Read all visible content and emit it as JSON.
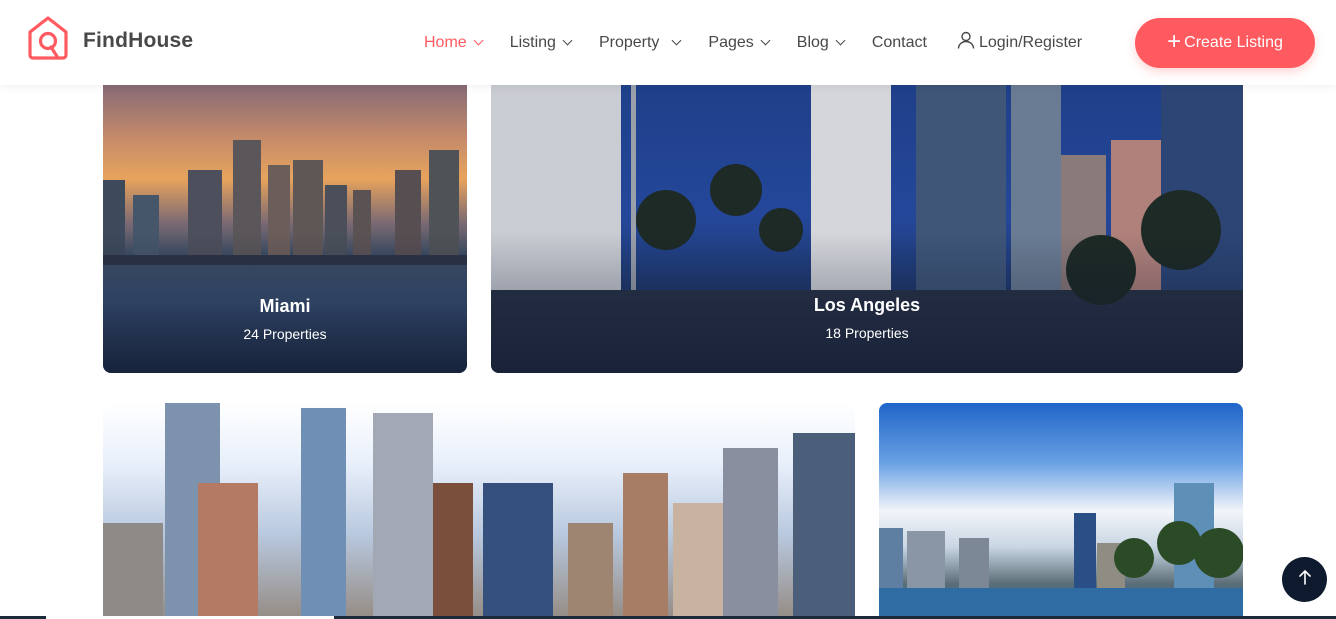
{
  "brand": {
    "name": "FindHouse",
    "accent": "#ff5a5f"
  },
  "nav": {
    "items": [
      {
        "label": "Home",
        "active": true,
        "dropdown": true
      },
      {
        "label": "Listing",
        "dropdown": true
      },
      {
        "label": "Property",
        "dropdown": true
      },
      {
        "label": "Pages",
        "dropdown": true
      },
      {
        "label": "Blog",
        "dropdown": true
      },
      {
        "label": "Contact",
        "dropdown": false
      }
    ],
    "login_label": "Login/Register",
    "cta_label": "Create Listing"
  },
  "cities": [
    {
      "name": "Miami",
      "properties": "24 Properties"
    },
    {
      "name": "Los Angeles",
      "properties": "18 Properties"
    },
    {
      "name": "",
      "properties": ""
    },
    {
      "name": "",
      "properties": ""
    }
  ],
  "icons": {
    "logo": "house-logo-icon",
    "user": "user-icon",
    "plus": "plus-icon",
    "back_to_top": "arrow-up-icon"
  },
  "scroll_progress": 0.25
}
